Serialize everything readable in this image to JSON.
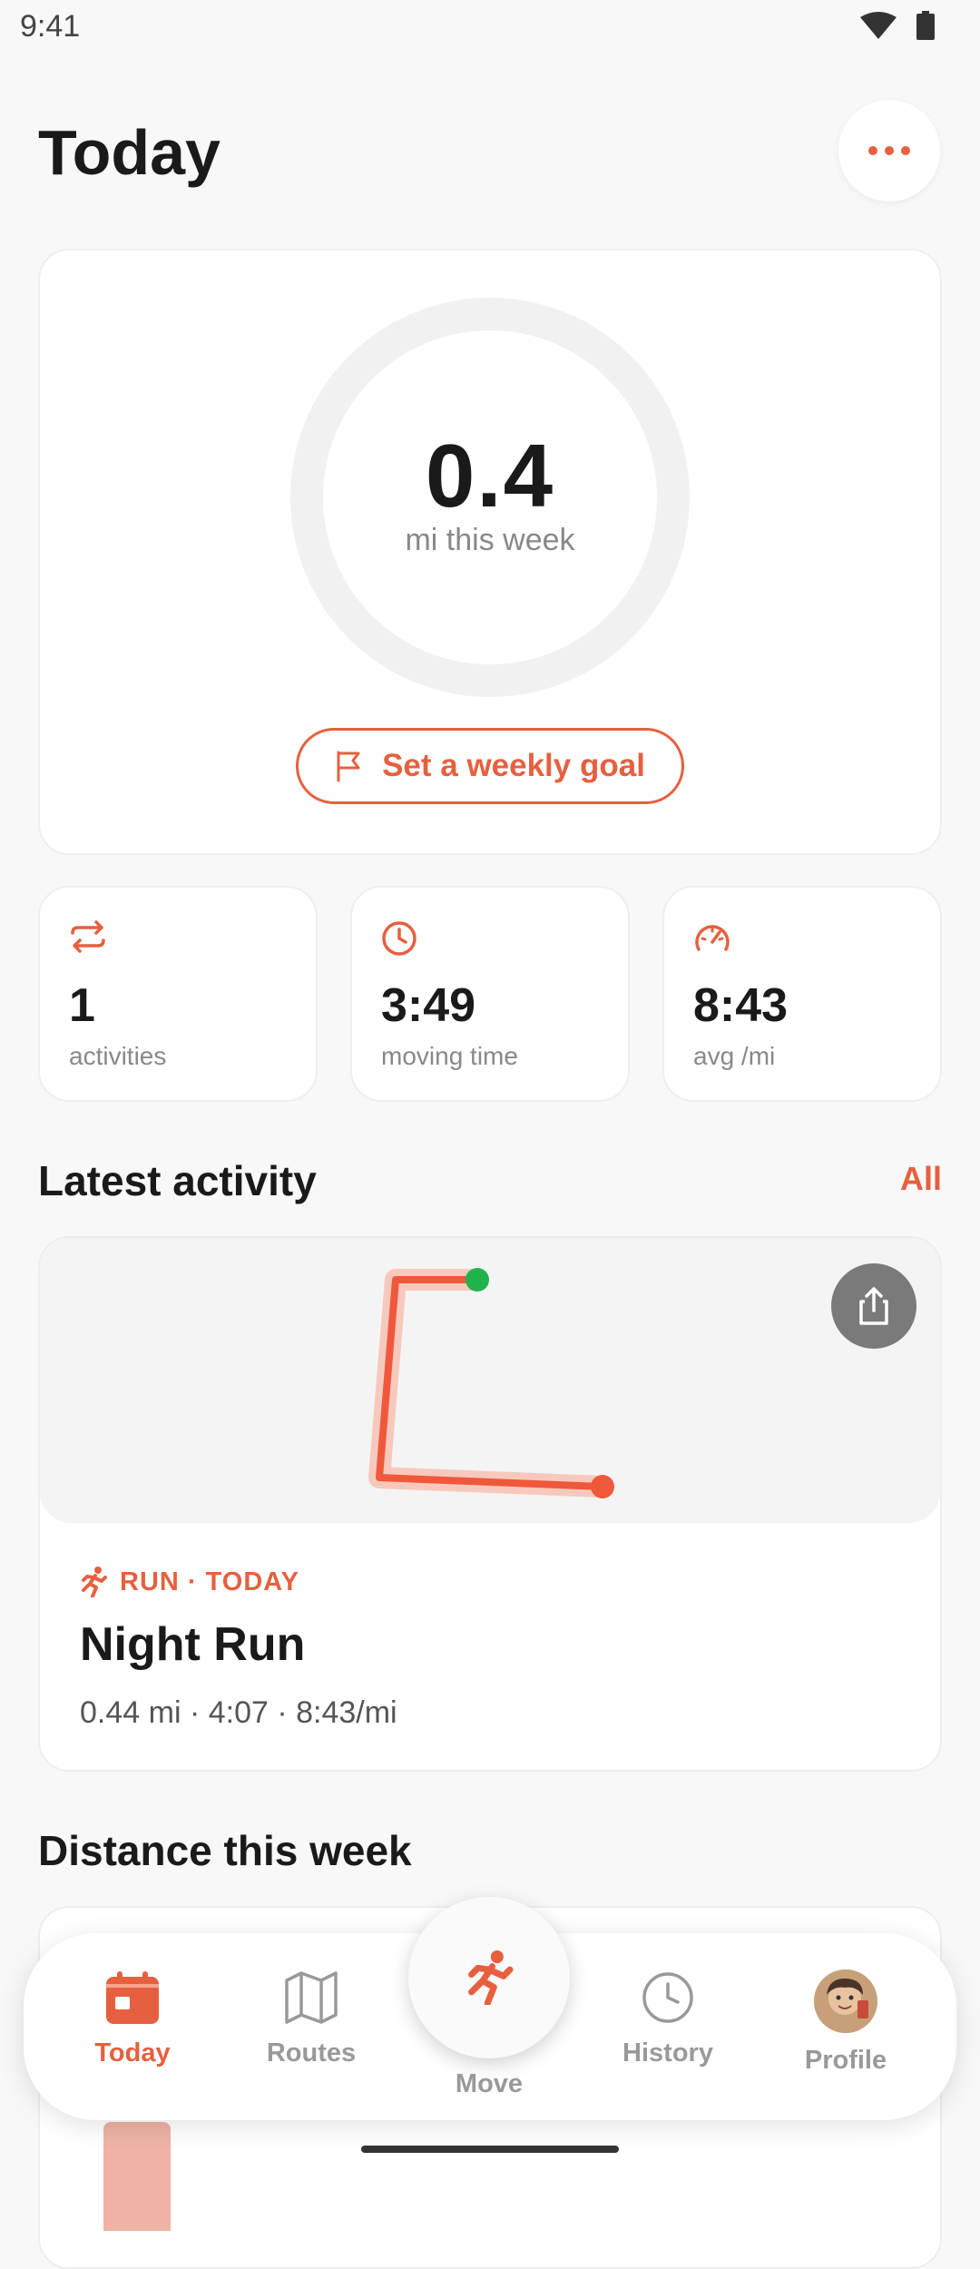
{
  "status_bar": {
    "time": "9:41"
  },
  "header": {
    "title": "Today"
  },
  "hero": {
    "value": "0.4",
    "unit": "mi this week",
    "goal_button_label": "Set a weekly goal",
    "progress": 0
  },
  "stats": [
    {
      "icon": "repeat-icon",
      "value": "1",
      "label": "activities"
    },
    {
      "icon": "clock-icon",
      "value": "3:49",
      "label": "moving time"
    },
    {
      "icon": "speedometer-icon",
      "value": "8:43",
      "label": "avg /mi"
    }
  ],
  "latest_activity": {
    "section_title": "Latest activity",
    "all_link": "All",
    "tag": "RUN · TODAY",
    "title": "Night Run",
    "stats": "0.44 mi · 4:07 · 8:43/mi"
  },
  "distance_section": {
    "title": "Distance this week"
  },
  "tabbar": {
    "tabs": [
      {
        "label": "Today",
        "icon": "calendar-icon",
        "active": true
      },
      {
        "label": "Routes",
        "icon": "map-icon",
        "active": false
      },
      {
        "label": "Move",
        "icon": "runner-icon",
        "active": false
      },
      {
        "label": "History",
        "icon": "clock-icon",
        "active": false
      },
      {
        "label": "Profile",
        "icon": "avatar",
        "active": false
      }
    ]
  },
  "colors": {
    "accent": "#e6603f",
    "start_marker": "#22b24c",
    "route": "#f0583b"
  }
}
